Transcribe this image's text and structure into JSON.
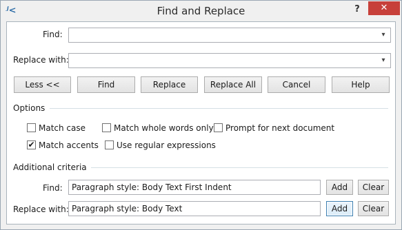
{
  "window": {
    "title": "Find and Replace",
    "app_icon": "ʲ<",
    "help_label": "?",
    "close_label": "✕"
  },
  "find": {
    "label": "Find:",
    "value": "",
    "arrow": "▾"
  },
  "replace": {
    "label": "Replace with:",
    "value": "",
    "arrow": "▾"
  },
  "buttons": {
    "less": "Less <<",
    "find": "Find",
    "replace": "Replace",
    "replace_all": "Replace All",
    "cancel": "Cancel",
    "help": "Help"
  },
  "options": {
    "title": "Options",
    "match_case": {
      "label": "Match case",
      "checked": false
    },
    "match_whole_words": {
      "label": "Match whole words only",
      "checked": false
    },
    "prompt_next_doc": {
      "label": "Prompt for next document",
      "checked": false
    },
    "match_accents": {
      "label": "Match accents",
      "checked": true
    },
    "regex": {
      "label": "Use regular expressions",
      "checked": false
    }
  },
  "criteria": {
    "title": "Additional criteria",
    "find_label": "Find:",
    "find_value": "Paragraph style: Body Text First Indent",
    "replace_label": "Replace with:",
    "replace_value": "Paragraph style: Body Text",
    "add_label": "Add",
    "clear_label": "Clear"
  },
  "glyphs": {
    "checkmark": "✔"
  },
  "colors": {
    "close_button": "#c7403a",
    "focus_border": "#3c7fb1",
    "accent_icon": "#2f6ea8"
  }
}
